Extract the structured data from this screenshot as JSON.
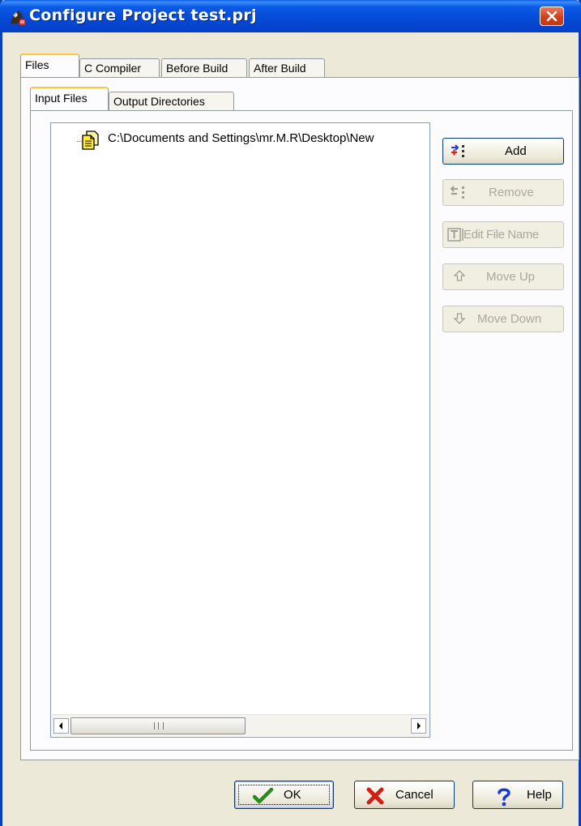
{
  "window": {
    "title": "Configure Project test.prj",
    "icon": "gnu-gcc-icon",
    "close_icon": "close-icon"
  },
  "main_tabs": [
    {
      "label": "Files",
      "active": true
    },
    {
      "label": "C Compiler",
      "active": false
    },
    {
      "label": "Before Build",
      "active": false
    },
    {
      "label": "After Build",
      "active": false
    }
  ],
  "sub_tabs": [
    {
      "label": "Input Files",
      "active": true
    },
    {
      "label": "Output Directories",
      "active": false
    }
  ],
  "file_tree": {
    "items": [
      {
        "label": "C:\\Documents and Settings\\mr.M.R\\Desktop\\New",
        "icon": "file-icon"
      }
    ],
    "scrollbar_grip": "III"
  },
  "side_buttons": {
    "add": {
      "label": "Add",
      "enabled": true,
      "icon": "add-list-icon"
    },
    "remove": {
      "label": "Remove",
      "enabled": false,
      "icon": "remove-list-icon"
    },
    "edit": {
      "label": "Edit File Name",
      "enabled": false,
      "icon": "text-edit-icon"
    },
    "move_up": {
      "label": "Move Up",
      "enabled": false,
      "icon": "arrow-up-icon"
    },
    "move_down": {
      "label": "Move Down",
      "enabled": false,
      "icon": "arrow-down-icon"
    }
  },
  "dialog_buttons": {
    "ok": {
      "label": "OK",
      "icon": "checkmark-icon"
    },
    "cancel": {
      "label": "Cancel",
      "icon": "x-icon"
    },
    "help": {
      "label": "Help",
      "icon": "question-icon"
    }
  },
  "colors": {
    "titlebar": "#0a5ae6",
    "window_bg": "#ece9d8",
    "close_button": "#d1401c",
    "active_tab_accent": "#ffc83c",
    "disabled_text": "#aca899"
  }
}
